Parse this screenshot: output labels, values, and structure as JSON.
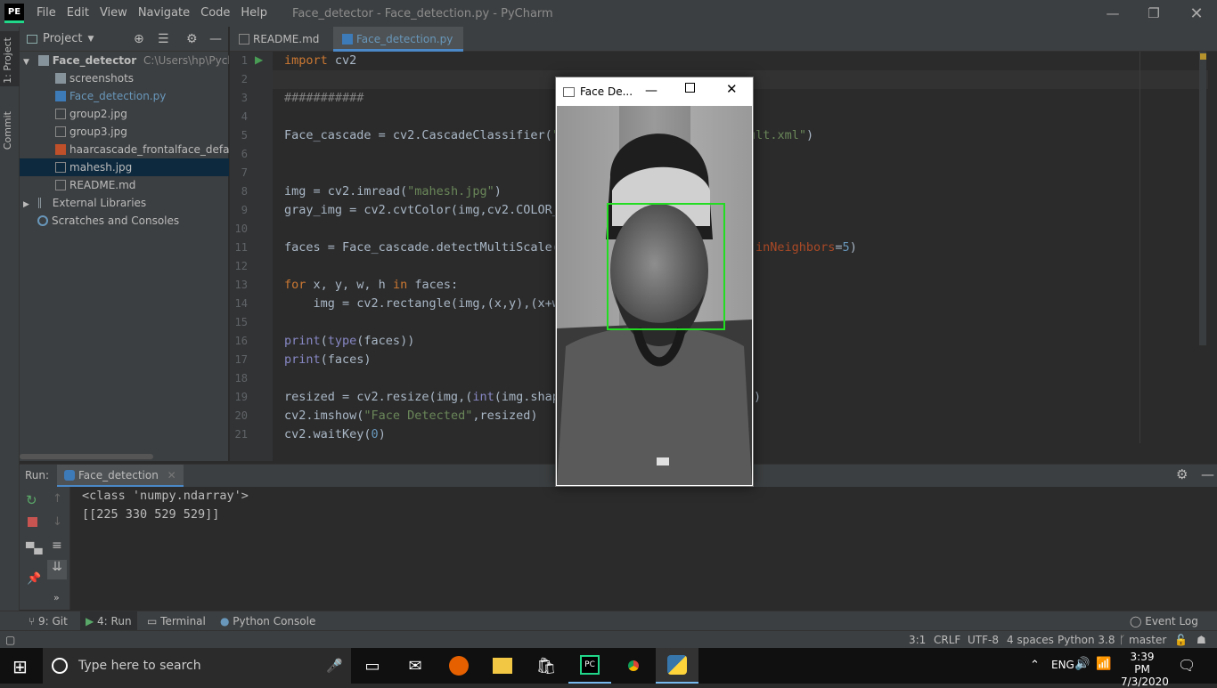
{
  "titlebar": {
    "logo": "PE",
    "menu": [
      "File",
      "Edit",
      "View",
      "Navigate",
      "Code",
      "Help"
    ],
    "title": "Face_detector - Face_detection.py - PyCharm"
  },
  "left_strip": {
    "project_tab": "1: Project",
    "commit_tab": "Commit"
  },
  "project_panel": {
    "header": "Project",
    "tree": [
      {
        "label": "Face_detector",
        "path": "C:\\Users\\hp\\Pycharm",
        "type": "folder-root"
      },
      {
        "label": "screenshots",
        "type": "folder"
      },
      {
        "label": "Face_detection.py",
        "type": "python"
      },
      {
        "label": "group2.jpg",
        "type": "image"
      },
      {
        "label": "group3.jpg",
        "type": "image"
      },
      {
        "label": "haarcascade_frontalface_default.x",
        "type": "xml"
      },
      {
        "label": "mahesh.jpg",
        "type": "image",
        "selected": true
      },
      {
        "label": "README.md",
        "type": "md"
      },
      {
        "label": "External Libraries",
        "type": "library"
      },
      {
        "label": "Scratches and Consoles",
        "type": "scratch"
      }
    ]
  },
  "editor": {
    "tabs": [
      {
        "label": "README.md",
        "active": false
      },
      {
        "label": "Face_detection.py",
        "active": true
      }
    ],
    "line_numbers": [
      "1",
      "2",
      "3",
      "4",
      "5",
      "6",
      "7",
      "8",
      "9",
      "10",
      "11",
      "12",
      "13",
      "14",
      "15",
      "16",
      "17",
      "18",
      "19",
      "20",
      "21"
    ]
  },
  "code_fragments": {
    "l1a": "import",
    "l1b": " cv2",
    "l3": "###########",
    "l5a": "Face_cascade = cv2.CascadeClassifier(",
    "l5b": "\"",
    "l5c": "ult.xml\"",
    "l5d": ")",
    "l8a": "img = cv2.imread(",
    "l8b": "\"mahesh.jpg\"",
    "l8c": ")",
    "l9": "gray_img = cv2.cvtColor(img,cv2.COLOR_",
    "l11a": "faces = Face_cascade.detectMultiScale(",
    "l11b": "inNeighbors",
    "l11c": "=",
    "l11d": "5",
    "l11e": ")",
    "l13a": "for",
    "l13b": " x, y, w, h ",
    "l13c": "in",
    "l13d": " faces:",
    "l14": "    img = cv2.rectangle(img,(x,y),(x+w",
    "l16a": "print",
    "l16b": "(",
    "l16c": "type",
    "l16d": "(faces))",
    "l17a": "print",
    "l17b": "(faces)",
    "l19a": "resized = cv2.resize(img,(",
    "l19b": "int",
    "l19c": "(img.shap",
    "l19d": ")",
    "l20a": "cv2.imshow(",
    "l20b": "\"Face Detected\"",
    "l20c": ",resized)",
    "l21a": "cv2.waitKey(",
    "l21b": "0",
    "l21c": ")"
  },
  "run_panel": {
    "label": "Run:",
    "tab": "Face_detection",
    "output": [
      "<class 'numpy.ndarray'>",
      "[[225 330 529 529]]"
    ]
  },
  "face_window": {
    "title": "Face De..."
  },
  "bottom_tabs": [
    "9: Git",
    "4: Run",
    "Terminal",
    "Python Console"
  ],
  "event_log": "Event Log",
  "status": {
    "position": "3:1",
    "line_sep": "CRLF",
    "encoding": "UTF-8",
    "indent": "4 spaces",
    "interpreter": "Python 3.8",
    "branch": "master"
  },
  "taskbar": {
    "search_placeholder": "Type here to search",
    "time": "3:39 PM",
    "date": "7/3/2020",
    "lang": "ENG"
  }
}
